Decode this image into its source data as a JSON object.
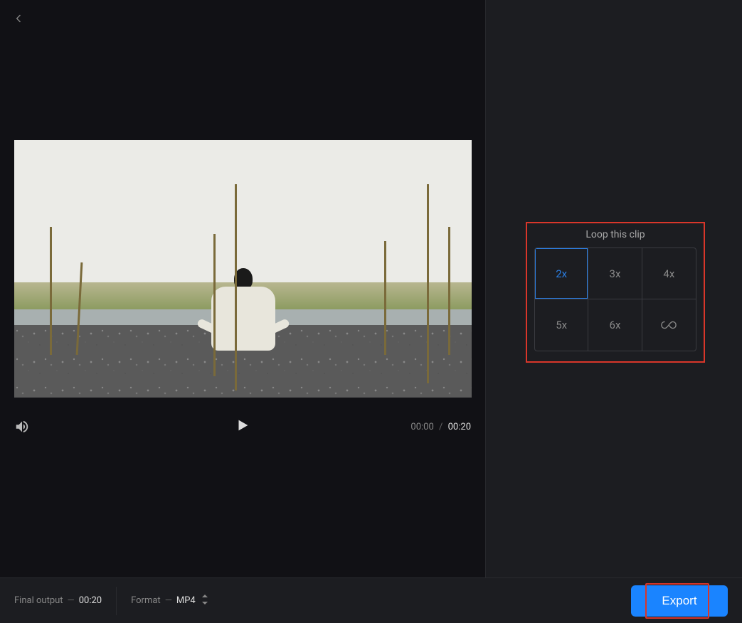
{
  "loop": {
    "title": "Loop this clip",
    "options": [
      "2x",
      "3x",
      "4x",
      "5x",
      "6x",
      "∞"
    ],
    "selected_index": 0
  },
  "player": {
    "current_time": "00:00",
    "separator": "/",
    "duration": "00:20"
  },
  "footer": {
    "final_output_label": "Final output",
    "final_output_value": "00:20",
    "format_label": "Format",
    "format_value": "MP4",
    "export_label": "Export"
  }
}
